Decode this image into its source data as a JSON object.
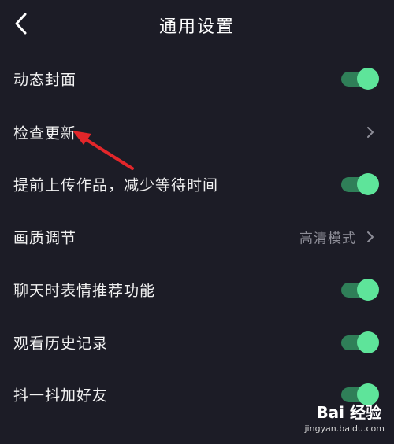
{
  "header": {
    "title": "通用设置",
    "back_icon": "chevron-left-icon"
  },
  "settings": [
    {
      "label": "动态封面",
      "control": "toggle",
      "enabled": true
    },
    {
      "label": "检查更新",
      "control": "chevron"
    },
    {
      "label": "提前上传作品，减少等待时间",
      "control": "toggle",
      "enabled": true
    },
    {
      "label": "画质调节",
      "control": "value",
      "value": "高清模式"
    },
    {
      "label": "聊天时表情推荐功能",
      "control": "toggle",
      "enabled": true
    },
    {
      "label": "观看历史记录",
      "control": "toggle",
      "enabled": true
    },
    {
      "label": "抖一抖加好友",
      "control": "toggle",
      "enabled": true
    }
  ],
  "annotation": {
    "type": "red-arrow",
    "points_to": "检查更新"
  },
  "watermark": {
    "logo": "Bai 经验",
    "url": "jingyan.baidu.com"
  },
  "colors": {
    "background": "#1c1c26",
    "toggle_track": "#2f7f58",
    "toggle_knob": "#5ee49a",
    "annotation_arrow": "#e3262a"
  }
}
